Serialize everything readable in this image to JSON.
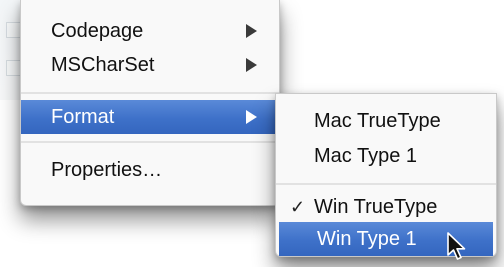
{
  "main_menu": {
    "items": [
      {
        "label": "Codepage",
        "has_submenu": true
      },
      {
        "label": "MSCharSet",
        "has_submenu": true
      },
      {
        "label": "Format",
        "has_submenu": true,
        "highlighted": true
      },
      {
        "label": "Properties…",
        "has_submenu": false
      }
    ]
  },
  "format_submenu": {
    "items": [
      {
        "label": "Mac TrueType",
        "checked": false
      },
      {
        "label": "Mac Type 1",
        "checked": false
      },
      {
        "label": "Win TrueType",
        "checked": true,
        "check_mark": "✓"
      },
      {
        "label": "Win Type 1",
        "checked": false,
        "highlighted": true
      }
    ]
  },
  "colors": {
    "highlight": "#3e71c9",
    "menu_background": "#f9f9f9",
    "text": "#111111",
    "highlight_text": "#ffffff"
  },
  "icons": {
    "submenu_arrow": "chevron-right-icon",
    "checkmark": "checkmark-icon",
    "cursor": "mouse-pointer-icon"
  }
}
